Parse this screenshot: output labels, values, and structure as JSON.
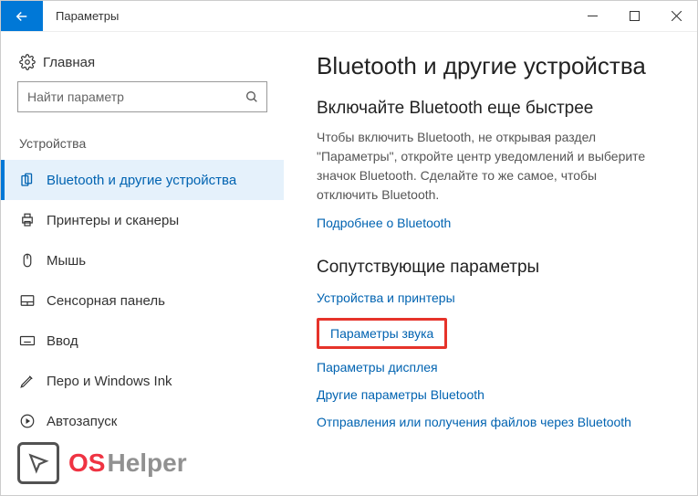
{
  "titlebar": {
    "title": "Параметры"
  },
  "home": {
    "label": "Главная"
  },
  "search": {
    "placeholder": "Найти параметр"
  },
  "sidebar": {
    "section_label": "Устройства",
    "items": [
      {
        "label": "Bluetooth и другие устройства",
        "active": true
      },
      {
        "label": "Принтеры и сканеры",
        "active": false
      },
      {
        "label": "Мышь",
        "active": false
      },
      {
        "label": "Сенсорная панель",
        "active": false
      },
      {
        "label": "Ввод",
        "active": false
      },
      {
        "label": "Перо и Windows Ink",
        "active": false
      },
      {
        "label": "Автозапуск",
        "active": false
      }
    ]
  },
  "main": {
    "heading": "Bluetooth и другие устройства",
    "sub_heading": "Включайте Bluetooth еще быстрее",
    "body": "Чтобы включить Bluetooth, не открывая раздел \"Параметры\", откройте центр уведомлений и выберите значок Bluetooth. Сделайте то же самое, чтобы отключить Bluetooth.",
    "learn_more": "Подробнее о Bluetooth",
    "related_heading": "Сопутствующие параметры",
    "related_links": [
      "Устройства и принтеры",
      "Параметры звука",
      "Параметры дисплея",
      "Другие параметры Bluetooth",
      "Отправления или получения файлов через Bluetooth"
    ],
    "highlighted_index": 1
  },
  "watermark": {
    "part1": "OS",
    "part2": "Helper"
  }
}
